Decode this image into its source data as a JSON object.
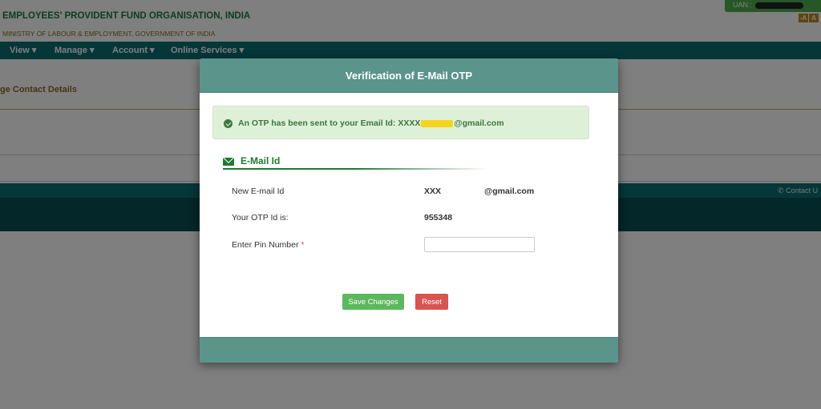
{
  "header": {
    "org_title": "EMPLOYEES' PROVIDENT FUND ORGANISATION, INDIA",
    "org_subtitle": "MINISTRY OF LABOUR & EMPLOYMENT, GOVERNMENT OF INDIA",
    "uan_label": "UAN :",
    "font_buttons": [
      "-A",
      "A"
    ]
  },
  "navbar": {
    "items": [
      {
        "label": "View ▾"
      },
      {
        "label": "Manage ▾"
      },
      {
        "label": "Account ▾"
      },
      {
        "label": "Online Services ▾"
      }
    ]
  },
  "page": {
    "heading": "ge Contact Details",
    "footer_contact": "Contact U"
  },
  "modal": {
    "title": "Verification of E-Mail OTP",
    "alert_prefix": "An OTP has been sent to your Email Id: XXXX",
    "alert_suffix": "@gmail.com",
    "section_title": "E-Mail Id",
    "fields": {
      "email_label": "New E-mail Id",
      "email_value_prefix": "XXX",
      "email_value_suffix": "@gmail.com",
      "otp_label": "Your OTP Id is:",
      "otp_value": "955348",
      "pin_label": "Enter Pin Number",
      "pin_required_mark": "*",
      "pin_value": ""
    },
    "buttons": {
      "save": "Save Changes",
      "reset": "Reset"
    }
  },
  "colors": {
    "modal_header": "#5a948b",
    "navbar": "#0b6e71",
    "alert_bg": "#dff0d8",
    "alert_text": "#3c763d",
    "save_button": "#5cb85c",
    "reset_button": "#d9534f"
  },
  "icons": {
    "alert": "check-circle-icon",
    "section": "envelope-icon",
    "contact": "phone-icon"
  }
}
